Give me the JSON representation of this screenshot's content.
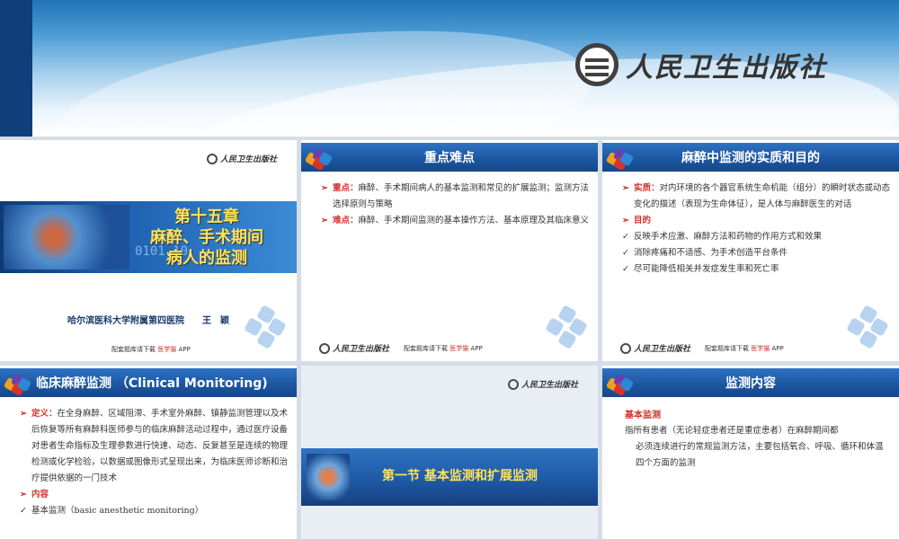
{
  "banner": {
    "publisher_logo": "人民卫生出版社"
  },
  "slide1": {
    "logo": "人民卫生出版社",
    "chapter_line1": "第十五章",
    "chapter_line2": "麻醉、手术期间",
    "chapter_line3": "病人的监测",
    "binary_text": "0101 10",
    "institution": "哈尔滨医科大学附属第四医院",
    "author": "王　颖",
    "footer_text": "配套题库请下载",
    "footer_app_name": "医学猫",
    "footer_app": "APP"
  },
  "slide2": {
    "title": "重点难点",
    "items": [
      {
        "key": "重点：",
        "text": "麻醉、手术期间病人的基本监测和常见的扩展监测；监测方法选择原则与策略"
      },
      {
        "key": "难点：",
        "text": "麻醉、手术期间监测的基本操作方法、基本原理及其临床意义"
      }
    ],
    "footer_logo": "人民卫生出版社",
    "footer_text": "配套题库请下载",
    "footer_app_name": "医学猫",
    "footer_app": "APP"
  },
  "slide3": {
    "title": "麻醉中监测的实质和目的",
    "essence_key": "实质：",
    "essence_text": "对内环境的各个器官系统生命机能（组分）的瞬时状态或动态变化的描述（表现为生命体征），是人体与麻醉医生的对话",
    "purpose_key": "目的",
    "checks": [
      "反映手术应激、麻醉方法和药物的作用方式和效果",
      "消除疼痛和不适感、为手术创造平台条件",
      "尽可能降低相关并发症发生率和死亡率"
    ],
    "footer_logo": "人民卫生出版社",
    "footer_text": "配套题库请下载",
    "footer_app_name": "医学猫",
    "footer_app": "APP"
  },
  "slide4": {
    "title": "临床麻醉监测 （Clinical Monitoring)",
    "definition_key": "定义：",
    "definition_text": "在全身麻醉、区域阻滞、手术室外麻醉、镇静监测管理以及术后恢复等所有麻醉科医师参与的临床麻醉活动过程中，通过医疗设备对患者生命指标及生理参数进行快速、动态、反复甚至是连续的物理检测或化学检验，以数据或图像形式呈现出来，为临床医师诊断和治疗提供依据的一门技术",
    "content_key": "内容",
    "check_item": "基本监测（basic anesthetic monitoring）"
  },
  "slide5": {
    "logo": "人民卫生出版社",
    "section_title": "第一节  基本监测和扩展监测"
  },
  "slide6": {
    "title": "监测内容",
    "heading": "基本监测",
    "para_line1": "指所有患者（无论轻症患者还是重症患者）在麻醉期间都",
    "para_rest": "必须连续进行的常规监测方法，主要包括氧合、呼吸、循环和体温四个方面的监测"
  }
}
